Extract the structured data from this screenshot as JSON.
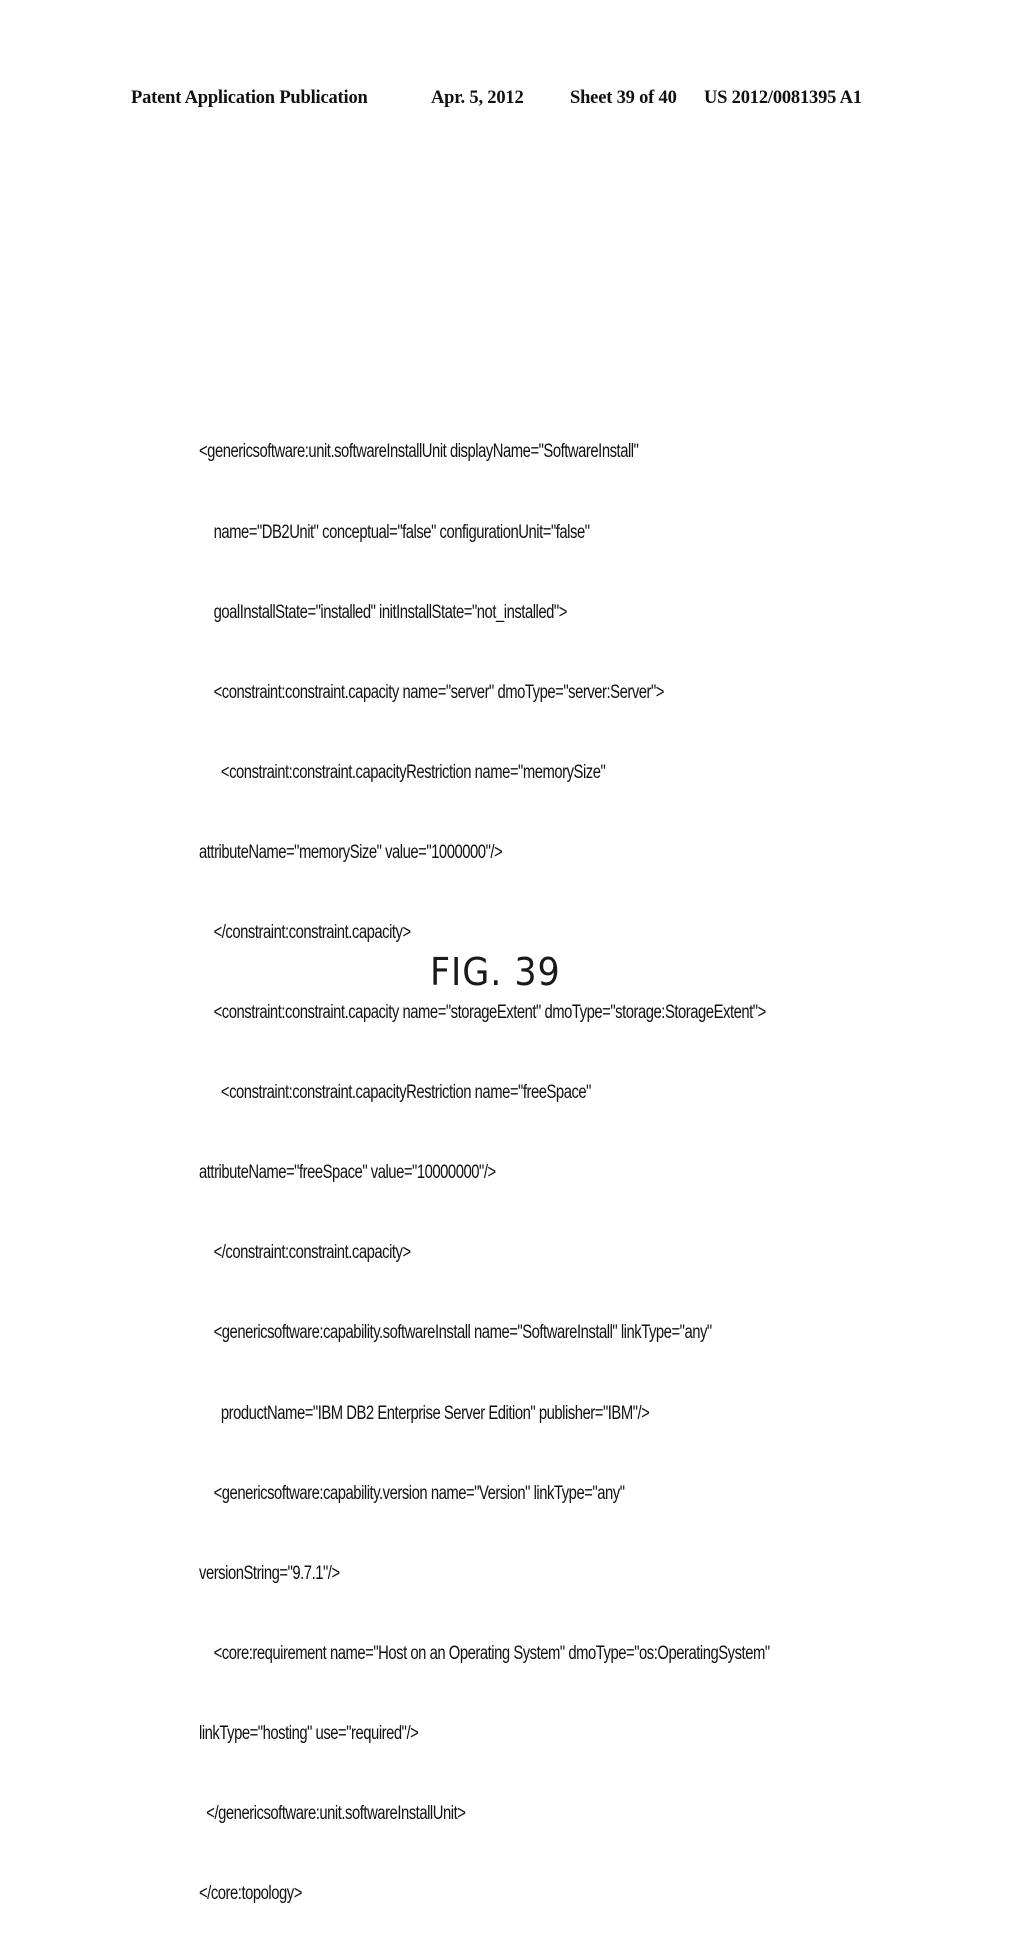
{
  "header": {
    "publication": "Patent Application Publication",
    "date": "Apr. 5, 2012",
    "sheet": "Sheet 39 of 40",
    "patent_number": "US 2012/0081395 A1"
  },
  "code_lines": [
    "<genericsoftware:unit.softwareInstallUnit displayName=\"SoftwareInstall\"",
    "    name=\"DB2Unit\" conceptual=\"false\" configurationUnit=\"false\"",
    "    goalInstallState=\"installed\" initInstallState=\"not_installed\">",
    "    <constraint:constraint.capacity name=\"server\" dmoType=\"server:Server\">",
    "      <constraint:constraint.capacityRestriction name=\"memorySize\"",
    "attributeName=\"memorySize\" value=\"1000000\"/>",
    "    </constraint:constraint.capacity>",
    "    <constraint:constraint.capacity name=\"storageExtent\" dmoType=\"storage:StorageExtent\">",
    "      <constraint:constraint.capacityRestriction name=\"freeSpace\"",
    "attributeName=\"freeSpace\" value=\"10000000\"/>",
    "    </constraint:constraint.capacity>",
    "    <genericsoftware:capability.softwareInstall name=\"SoftwareInstall\" linkType=\"any\"",
    "      productName=\"IBM DB2 Enterprise Server Edition\" publisher=\"IBM\"/>",
    "    <genericsoftware:capability.version name=\"Version\" linkType=\"any\"",
    "versionString=\"9.7.1\"/>",
    "    <core:requirement name=\"Host on an Operating System\" dmoType=\"os:OperatingSystem\"",
    "linkType=\"hosting\" use=\"required\"/>",
    "  </genericsoftware:unit.softwareInstallUnit>",
    "</core:topology>"
  ],
  "figure_label": "FIG. 39"
}
